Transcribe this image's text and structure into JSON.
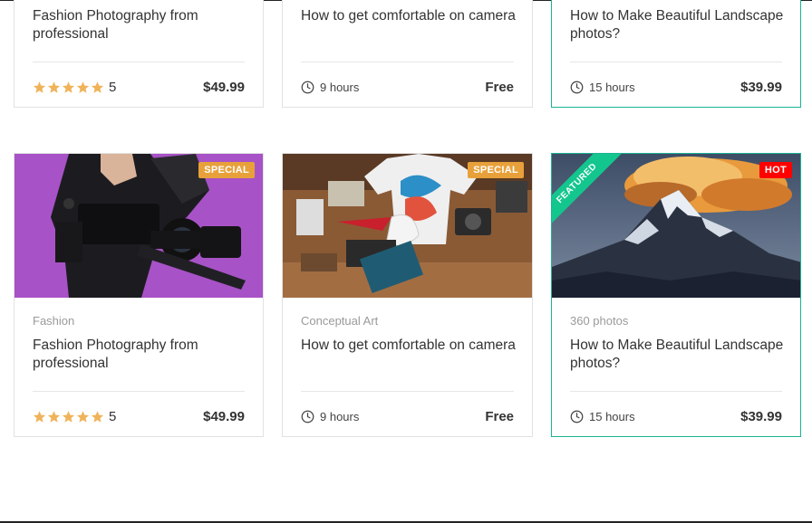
{
  "top_row": [
    {
      "title": "Fashion Photography from professional",
      "meta_type": "rating",
      "rating": "5",
      "price": "$49.99"
    },
    {
      "title": "How to get comfortable on camera",
      "meta_type": "duration",
      "duration": "9 hours",
      "price": "Free"
    },
    {
      "title": "How to Make Beautiful Landscape photos?",
      "meta_type": "duration",
      "duration": "15 hours",
      "price": "$39.99",
      "featured": true
    }
  ],
  "bottom_row": [
    {
      "category": "Fashion",
      "badge": "SPECIAL",
      "title": "Fashion Photography from professional",
      "rating": "5",
      "price": "$49.99"
    },
    {
      "category": "Conceptual Art",
      "badge": "SPECIAL",
      "title": "How to get comfortable on camera",
      "duration": "9 hours",
      "price": "Free"
    },
    {
      "category": "360 photos",
      "badge": "HOT",
      "ribbon": "FEATURED",
      "title": "How to Make Beautiful Landscape photos?",
      "duration": "15 hours",
      "price": "$39.99"
    }
  ],
  "colors": {
    "special_badge": "#e8a13a",
    "hot_badge": "#ff0000",
    "featured_ribbon": "#13c68e",
    "featured_border": "#1bb394",
    "star": "#f0b35a"
  },
  "icons": {
    "rating": "star-icon",
    "duration": "clock-icon"
  }
}
